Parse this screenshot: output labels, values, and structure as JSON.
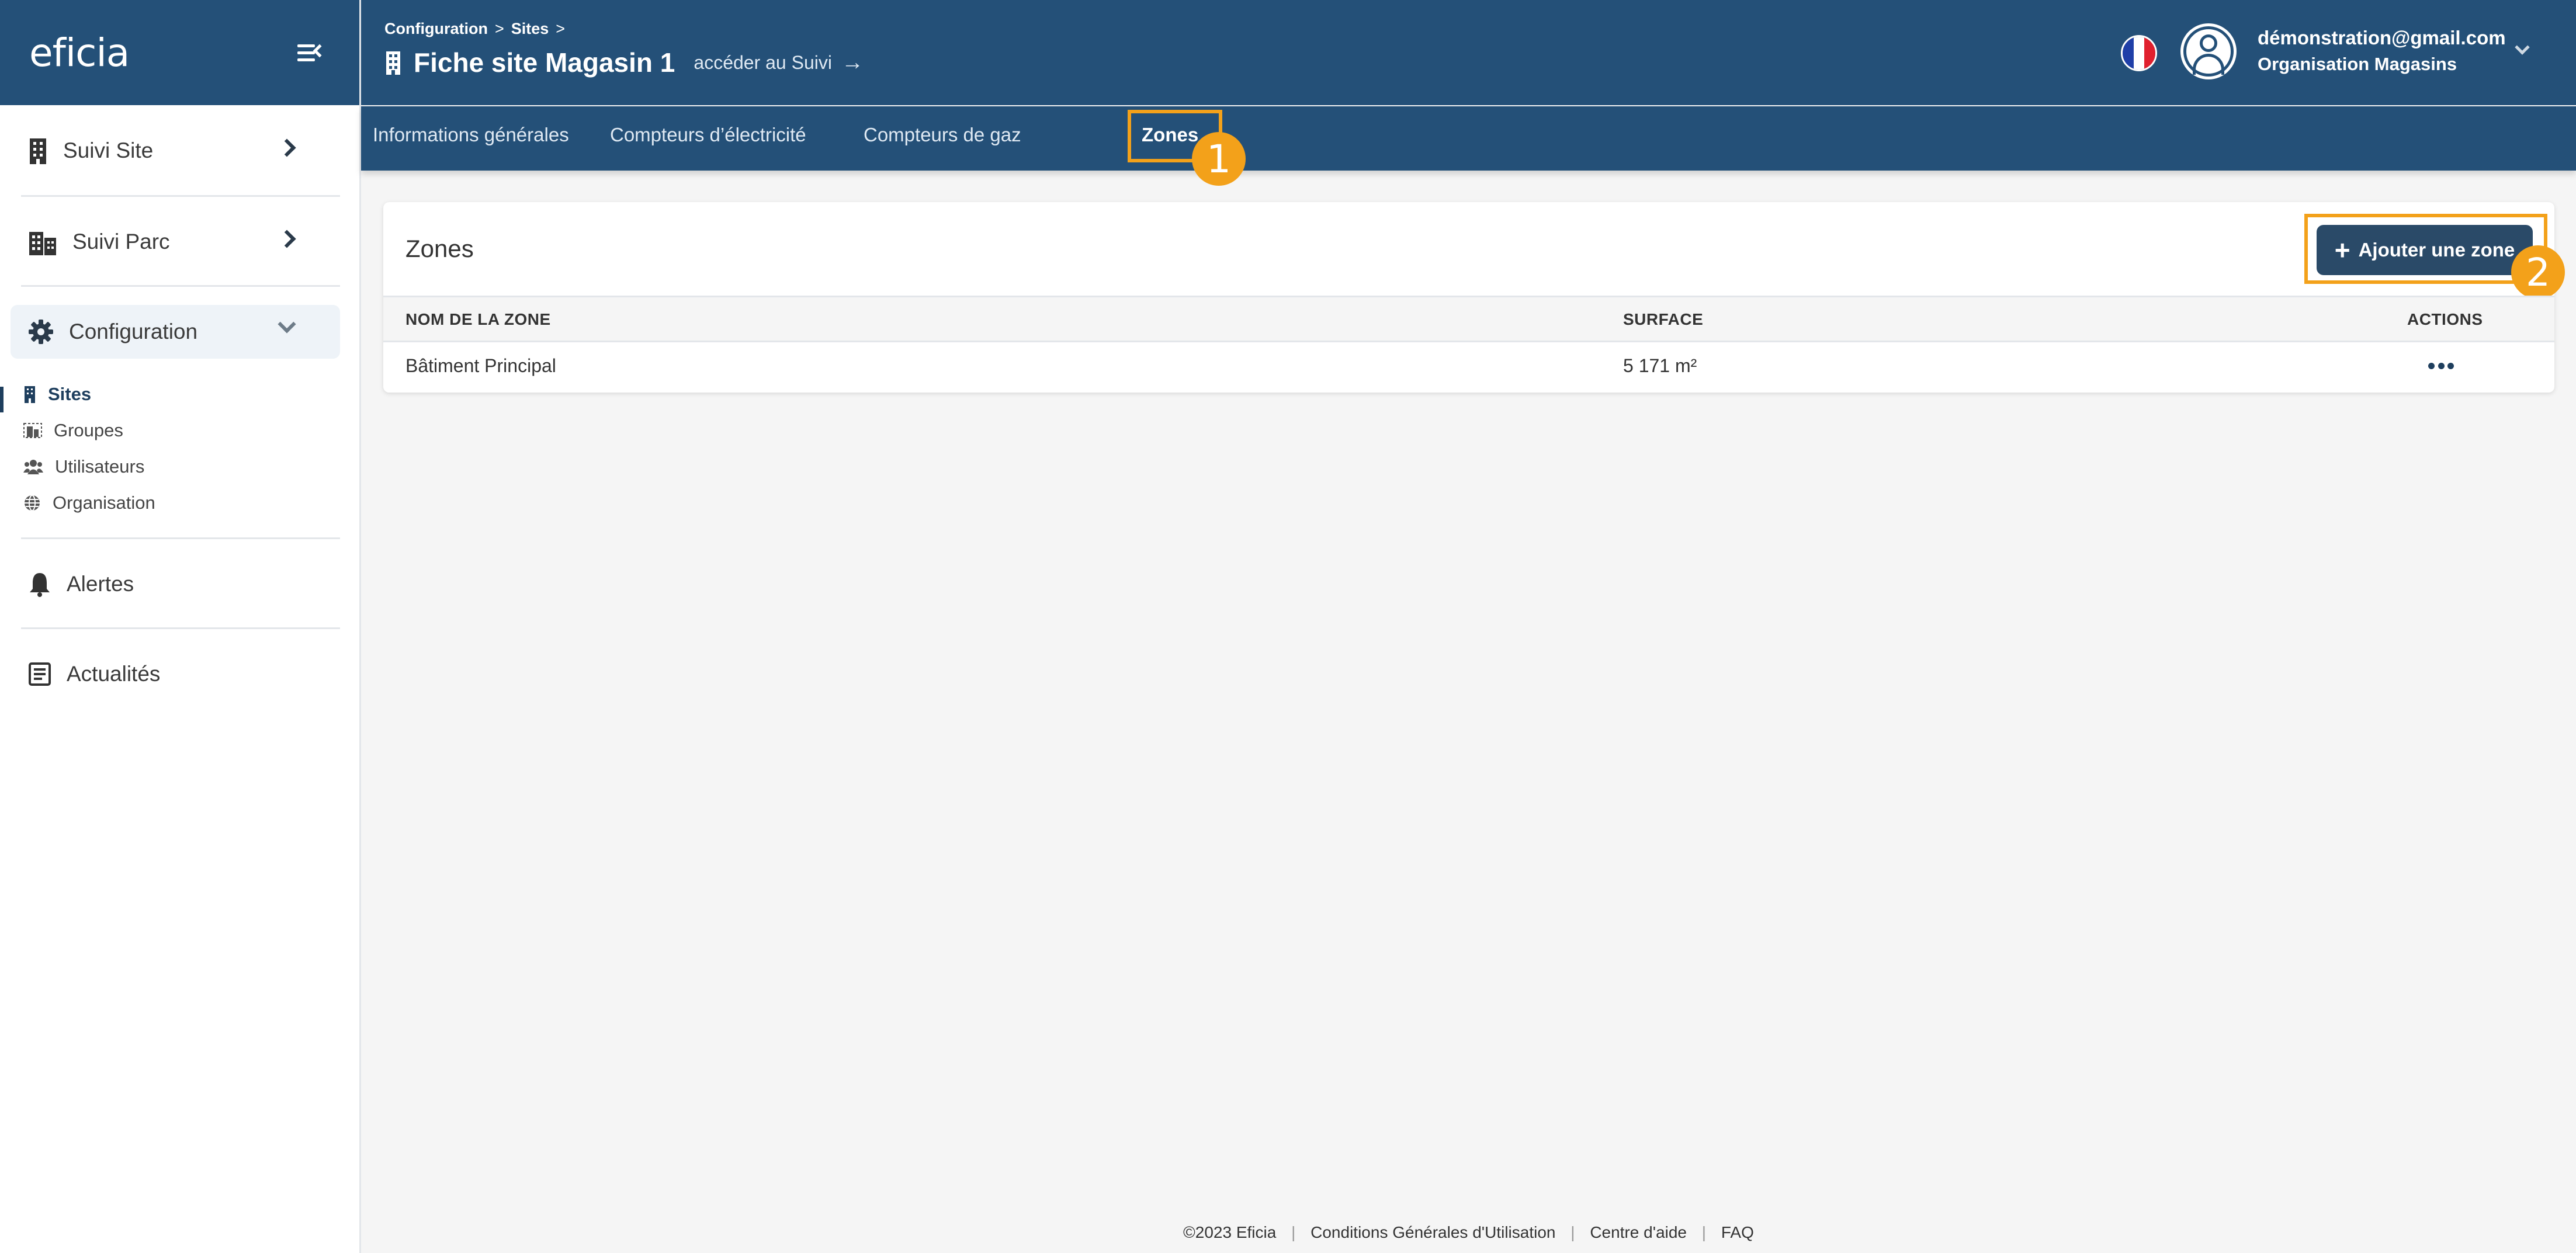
{
  "brand": {
    "logo": "eficia"
  },
  "sidebar": {
    "items": [
      {
        "label": "Suivi Site"
      },
      {
        "label": "Suivi Parc"
      },
      {
        "label": "Configuration"
      },
      {
        "label": "Alertes"
      },
      {
        "label": "Actualités"
      }
    ],
    "config_items": [
      {
        "label": "Sites"
      },
      {
        "label": "Groupes"
      },
      {
        "label": "Utilisateurs"
      },
      {
        "label": "Organisation"
      }
    ]
  },
  "header": {
    "breadcrumb": [
      "Configuration",
      "Sites"
    ],
    "breadcrumb_sep": ">",
    "page_title": "Fiche site Magasin 1",
    "suivi_link": "accéder au Suivi",
    "user_email": "démonstration@gmail.com",
    "user_org": "Organisation Magasins"
  },
  "tabs": [
    {
      "label": "Informations générales"
    },
    {
      "label": "Compteurs d’électricité"
    },
    {
      "label": "Compteurs de gaz"
    },
    {
      "label": "Zones"
    }
  ],
  "annotations": {
    "badge1": "1",
    "badge2": "2"
  },
  "card": {
    "title": "Zones",
    "add_button": "Ajouter une zone",
    "columns": [
      "NOM DE LA ZONE",
      "SURFACE",
      "ACTIONS"
    ],
    "rows": [
      {
        "name": "Bâtiment Principal",
        "surface": "5 171 m²"
      }
    ]
  },
  "footer": {
    "copyright": "©2023 Eficia",
    "links": [
      "Conditions Générales d'Utilisation",
      "Centre d'aide",
      "FAQ"
    ]
  },
  "colors": {
    "header_bg": "#245078",
    "accent": "#f3a11a",
    "button_bg": "#2a4a68"
  }
}
